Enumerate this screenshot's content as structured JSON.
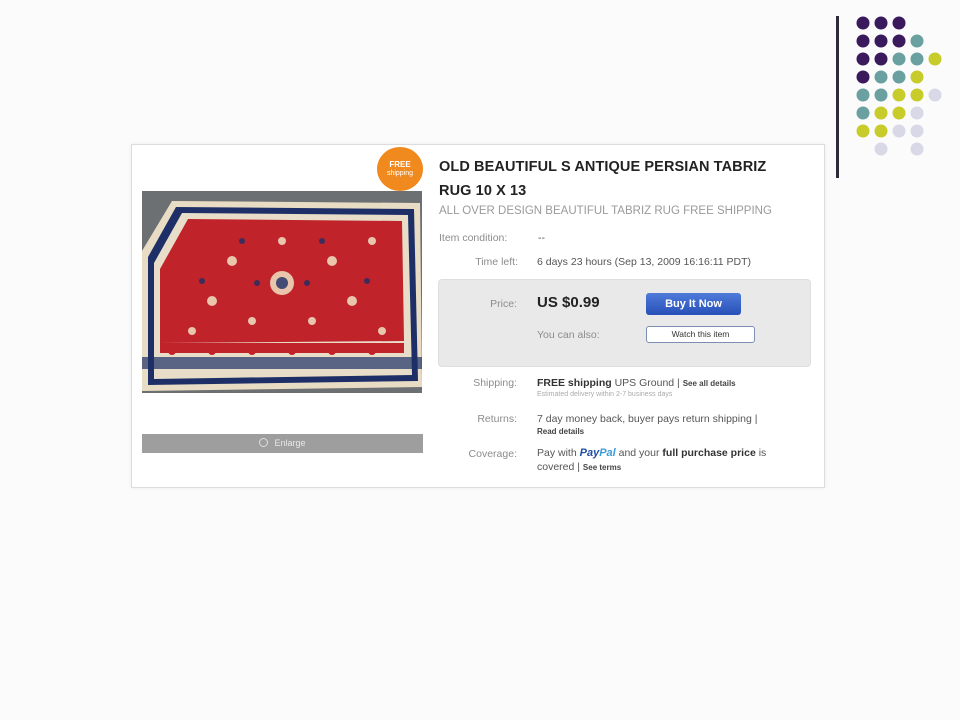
{
  "listing": {
    "badge_line1": "FREE",
    "badge_line2": "shipping",
    "title": "OLD BEAUTIFUL S ANTIQUE PERSIAN TABRIZ RUG 10 X 13",
    "subtitle": "ALL OVER DESIGN BEAUTIFUL TABRIZ RUG FREE SHIPPING",
    "enlarge_label": "Enlarge",
    "condition_label": "Item condition:",
    "condition_value": "--",
    "time_left_label": "Time left:",
    "time_left_value": "6 days 23 hours (Sep 13, 2009   16:16:11 PDT)",
    "price_label": "Price:",
    "price_value": "US $0.99",
    "buy_now_label": "Buy It Now",
    "you_can_also_label": "You can also:",
    "watch_label": "Watch this item",
    "shipping_label": "Shipping:",
    "shipping_free": "FREE shipping",
    "shipping_carrier": "UPS Ground |",
    "shipping_details_link": "See all details",
    "shipping_estimate": "Estimated delivery within 2-7 business days",
    "returns_label": "Returns:",
    "returns_text": "7 day money back, buyer pays return shipping |",
    "returns_link": "Read details",
    "coverage_label": "Coverage:",
    "coverage_pay_with": "Pay with",
    "coverage_paypal_a": "Pay",
    "coverage_paypal_b": "Pal",
    "coverage_and_your": "and your",
    "coverage_full_price": "full purchase price",
    "coverage_is": "is",
    "coverage_covered": "covered |",
    "coverage_link": "See terms"
  },
  "colors": {
    "dark_purple": "#3a1a5c",
    "teal": "#6aa0a0",
    "olive": "#c8cc2a",
    "lavender": "#d8d8e6",
    "badge_orange": "#f08a1e",
    "buy_blue": "#2f5cc4",
    "rug_red": "#c0232a"
  },
  "icons": {
    "enlarge": "magnifier-icon"
  }
}
